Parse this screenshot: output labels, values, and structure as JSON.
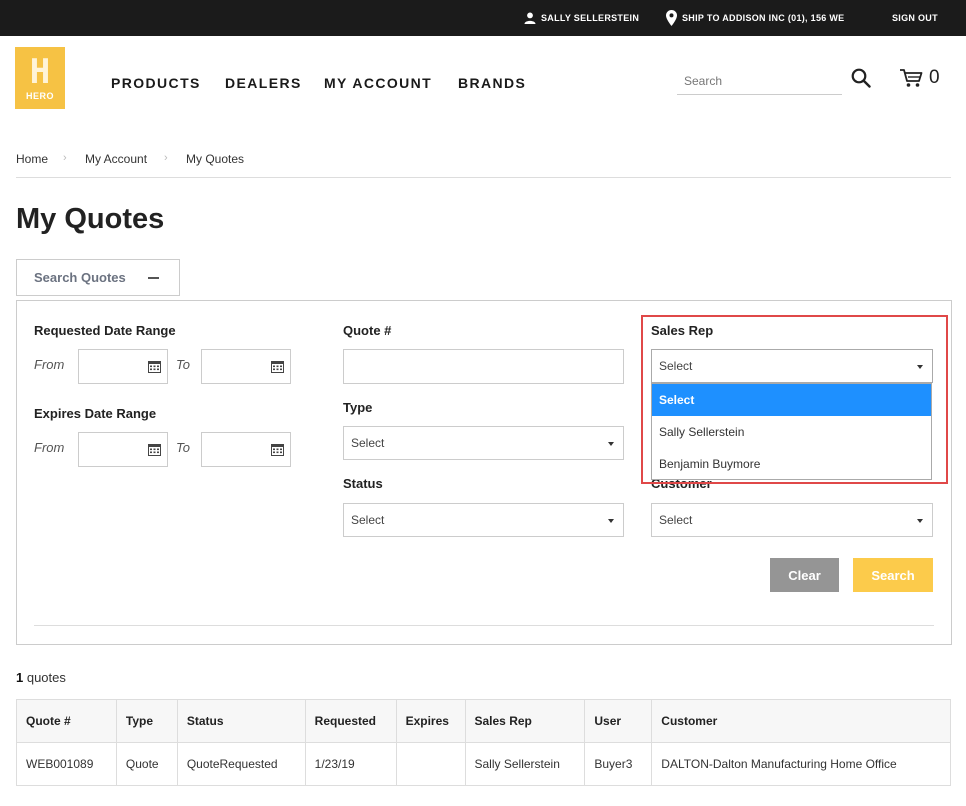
{
  "topbar": {
    "user": "SALLY SELLERSTEIN",
    "ship_to": "SHIP TO ADDISON INC (01), 156 WE",
    "sign_out": "SIGN OUT"
  },
  "header": {
    "logo_text": "HERO",
    "nav": [
      "PRODUCTS",
      "DEALERS",
      "MY ACCOUNT",
      "BRANDS"
    ],
    "search_placeholder": "Search",
    "cart_count": "0"
  },
  "breadcrumb": [
    "Home",
    "My Account",
    "My Quotes"
  ],
  "page_title": "My Quotes",
  "search_tab_label": "Search Quotes",
  "form": {
    "requested_label": "Requested Date Range",
    "expires_label": "Expires Date Range",
    "from": "From",
    "to": "To",
    "quote_label": "Quote #",
    "type_label": "Type",
    "status_label": "Status",
    "sales_rep_label": "Sales Rep",
    "customer_label": "Customer",
    "select_value": "Select",
    "sales_rep_options": [
      "Select",
      "Sally Sellerstein",
      "Benjamin Buymore"
    ],
    "clear_button": "Clear",
    "search_button": "Search"
  },
  "results": {
    "count": "1",
    "count_suffix": " quotes",
    "columns": [
      "Quote #",
      "Type",
      "Status",
      "Requested",
      "Expires",
      "Sales Rep",
      "User",
      "Customer"
    ],
    "rows": [
      [
        "WEB001089",
        "Quote",
        "QuoteRequested",
        "1/23/19",
        "",
        "Sally Sellerstein",
        "Buyer3",
        "DALTON-Dalton Manufacturing Home Office"
      ]
    ]
  }
}
